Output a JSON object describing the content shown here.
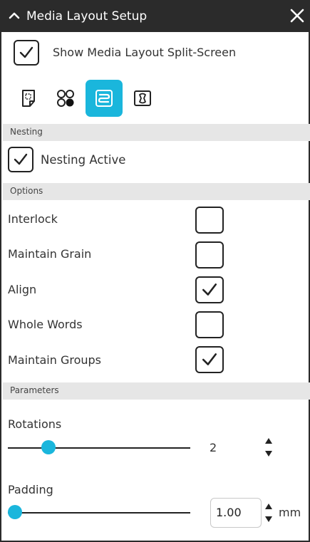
{
  "window": {
    "title": "Media Layout Setup"
  },
  "show_split": {
    "label": "Show Media Layout Split-Screen",
    "checked": true
  },
  "toolbar": {
    "buttons": [
      {
        "icon": "page-layout-icon",
        "active": false
      },
      {
        "icon": "circles-icon",
        "active": false
      },
      {
        "icon": "nesting-icon",
        "active": true
      },
      {
        "icon": "fit-frame-icon",
        "active": false
      }
    ],
    "accent": "#1ab6dc"
  },
  "nesting": {
    "section_label": "Nesting",
    "active_label": "Nesting Active",
    "active_checked": true
  },
  "options": {
    "section_label": "Options",
    "items": [
      {
        "label": "Interlock",
        "checked": false
      },
      {
        "label": "Maintain Grain",
        "checked": false
      },
      {
        "label": "Align",
        "checked": true
      },
      {
        "label": "Whole Words",
        "checked": false
      },
      {
        "label": "Maintain Groups",
        "checked": true
      }
    ]
  },
  "parameters": {
    "section_label": "Parameters",
    "rotations": {
      "label": "Rotations",
      "value": "2"
    },
    "padding": {
      "label": "Padding",
      "value": "1.00",
      "unit": "mm"
    }
  }
}
